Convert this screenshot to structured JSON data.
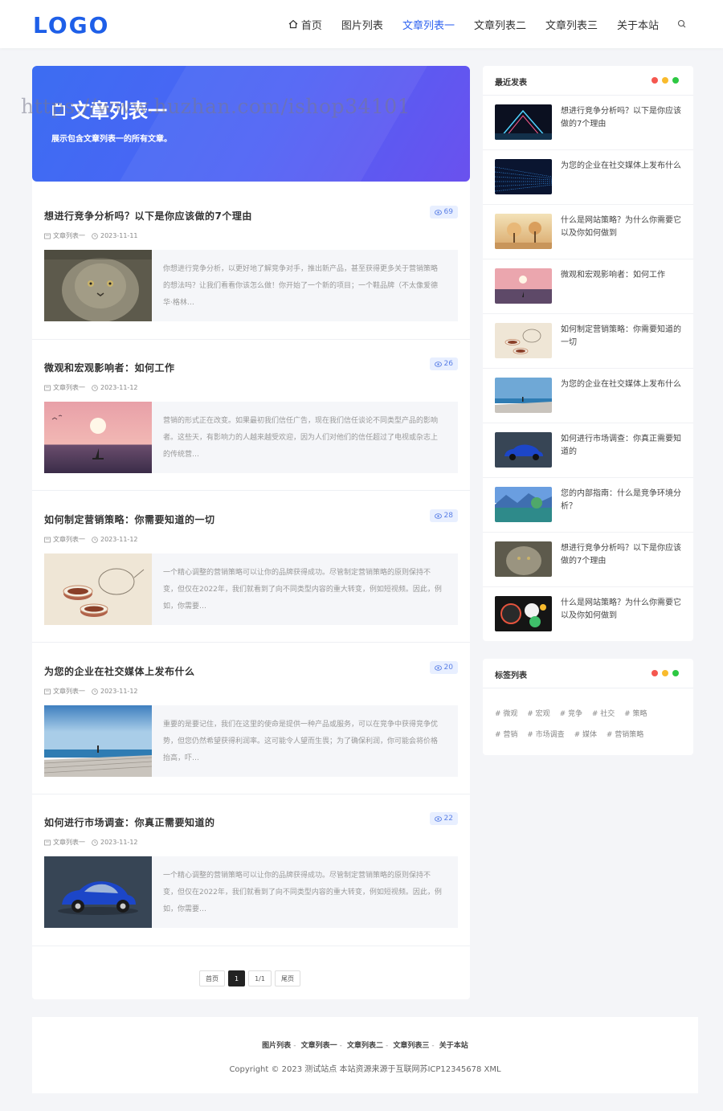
{
  "header": {
    "logo": "LOGO",
    "nav": [
      {
        "label": "首页",
        "icon": "home-icon"
      },
      {
        "label": "图片列表"
      },
      {
        "label": "文章列表一",
        "active": true
      },
      {
        "label": "文章列表二"
      },
      {
        "label": "文章列表三"
      },
      {
        "label": "关于本站"
      }
    ],
    "search_icon": "search-icon"
  },
  "hero": {
    "title": "文章列表一",
    "description": "展示包含文章列表一的所有文章。",
    "watermark": "https://www.huzhan.com/ishop34101"
  },
  "articles": [
    {
      "title": "想进行竞争分析吗？以下是你应该做的7个理由",
      "views": "69",
      "category": "文章列表一",
      "date": "2023-11-11",
      "excerpt": "你想进行竞争分析，以更好地了解竞争对手，推出新产品，甚至获得更多关于营销策略的想法吗？让我们看看你该怎么做！你开始了一个新的项目；一个鞋品牌（不太像爱德华·格林…",
      "thumb": "cat"
    },
    {
      "title": "微观和宏观影响者：如何工作",
      "views": "26",
      "category": "文章列表一",
      "date": "2023-11-12",
      "excerpt": "营销的形式正在改变。如果最初我们信任广告，现在我们信任谈论不同类型产品的影响者。这些天，有影响力的人越来越受欢迎，因为人们对他们的信任超过了电视或杂志上的传统营…",
      "thumb": "sunset-boat"
    },
    {
      "title": "如何制定营销策略：你需要知道的一切",
      "views": "28",
      "category": "文章列表一",
      "date": "2023-11-12",
      "excerpt": "一个精心调整的营销策略可以让你的品牌获得成功。尽管制定营销策略的原则保持不变，但仅在2022年，我们就看到了向不同类型内容的重大转变，例如短视频。因此，例如，你需要…",
      "thumb": "teapot"
    },
    {
      "title": "为您的企业在社交媒体上发布什么",
      "views": "20",
      "category": "文章列表一",
      "date": "2023-11-12",
      "excerpt": "重要的是要记住，我们在这里的使命是提供一种产品或服务，可以在竞争中获得竞争优势，但您仍然希望获得利润率。这可能令人望而生畏；为了确保利润，你可能会将价格抬高，吓…",
      "thumb": "pier"
    },
    {
      "title": "如何进行市场调查：你真正需要知道的",
      "views": "22",
      "category": "文章列表一",
      "date": "2023-11-12",
      "excerpt": "一个精心调整的营销策略可以让你的品牌获得成功。尽管制定营销策略的原则保持不变，但仅在2022年，我们就看到了向不同类型内容的重大转变，例如短视频。因此，例如，你需要…",
      "thumb": "car"
    }
  ],
  "pagination": {
    "first": "首页",
    "current": "1",
    "pages": "1/1",
    "last": "尾页"
  },
  "recent": {
    "title": "最近发表",
    "items": [
      {
        "title": "想进行竞争分析吗？以下是你应该做的7个理由",
        "thumb": "neon"
      },
      {
        "title": "为您的企业在社交媒体上发布什么",
        "thumb": "data"
      },
      {
        "title": "什么是网站策略？为什么你需要它以及你如何做到",
        "thumb": "trees"
      },
      {
        "title": "微观和宏观影响者：如何工作",
        "thumb": "sunset-boat"
      },
      {
        "title": "如何制定营销策略：你需要知道的一切",
        "thumb": "teapot"
      },
      {
        "title": "为您的企业在社交媒体上发布什么",
        "thumb": "pier"
      },
      {
        "title": "如何进行市场调查：你真正需要知道的",
        "thumb": "car"
      },
      {
        "title": "您的内部指南：什么是竞争环境分析？",
        "thumb": "lake"
      },
      {
        "title": "想进行竞争分析吗？以下是你应该做的7个理由",
        "thumb": "cat"
      },
      {
        "title": "什么是网站策略？为什么你需要它以及你如何做到",
        "thumb": "circles"
      }
    ]
  },
  "tags": {
    "title": "标签列表",
    "items": [
      "# 微观",
      "# 宏观",
      "# 竞争",
      "# 社交",
      "# 策略",
      "# 营销",
      "# 市场调查",
      "# 媒体",
      "# 营销策略"
    ]
  },
  "window_dots": [
    "#f5574f",
    "#f9bb2d",
    "#2dc842"
  ],
  "footer": {
    "links": [
      "图片列表",
      "文章列表一",
      "文章列表二",
      "文章列表三",
      "关于本站"
    ],
    "copyright": "Copyright © 2023 测试站点 本站资源来源于互联网苏ICP12345678 XML"
  },
  "colors": {
    "accent": "#2f63f0",
    "logo": "#1e5fe8"
  }
}
